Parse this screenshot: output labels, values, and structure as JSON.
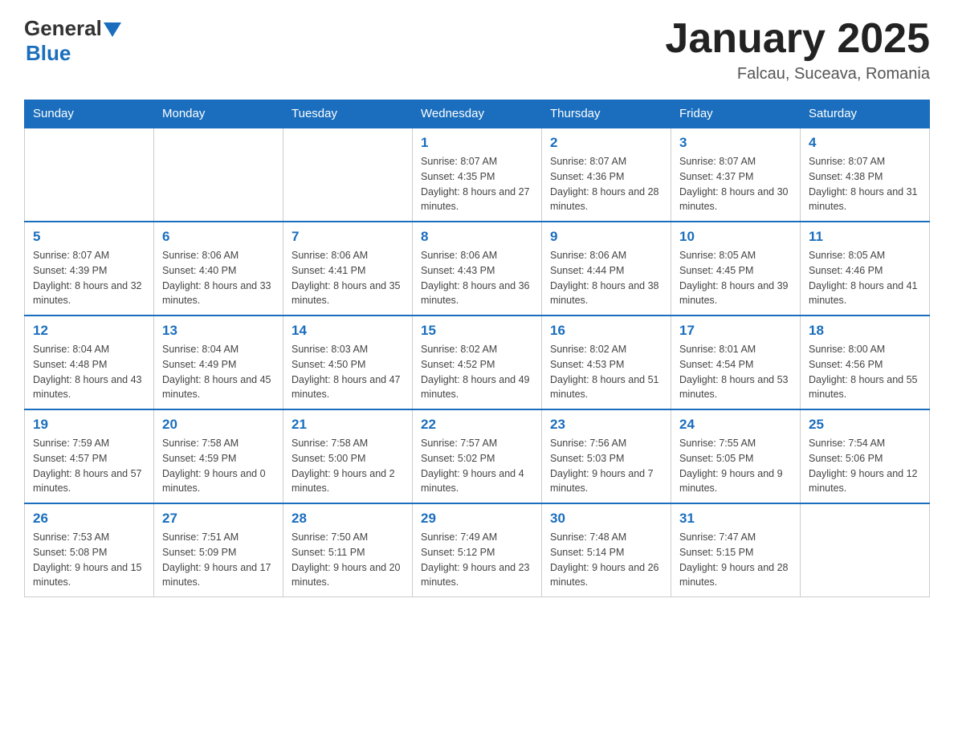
{
  "header": {
    "title": "January 2025",
    "location": "Falcau, Suceava, Romania",
    "logo_general": "General",
    "logo_blue": "Blue"
  },
  "days_of_week": [
    "Sunday",
    "Monday",
    "Tuesday",
    "Wednesday",
    "Thursday",
    "Friday",
    "Saturday"
  ],
  "weeks": [
    [
      {
        "day": "",
        "info": ""
      },
      {
        "day": "",
        "info": ""
      },
      {
        "day": "",
        "info": ""
      },
      {
        "day": "1",
        "info": "Sunrise: 8:07 AM\nSunset: 4:35 PM\nDaylight: 8 hours\nand 27 minutes."
      },
      {
        "day": "2",
        "info": "Sunrise: 8:07 AM\nSunset: 4:36 PM\nDaylight: 8 hours\nand 28 minutes."
      },
      {
        "day": "3",
        "info": "Sunrise: 8:07 AM\nSunset: 4:37 PM\nDaylight: 8 hours\nand 30 minutes."
      },
      {
        "day": "4",
        "info": "Sunrise: 8:07 AM\nSunset: 4:38 PM\nDaylight: 8 hours\nand 31 minutes."
      }
    ],
    [
      {
        "day": "5",
        "info": "Sunrise: 8:07 AM\nSunset: 4:39 PM\nDaylight: 8 hours\nand 32 minutes."
      },
      {
        "day": "6",
        "info": "Sunrise: 8:06 AM\nSunset: 4:40 PM\nDaylight: 8 hours\nand 33 minutes."
      },
      {
        "day": "7",
        "info": "Sunrise: 8:06 AM\nSunset: 4:41 PM\nDaylight: 8 hours\nand 35 minutes."
      },
      {
        "day": "8",
        "info": "Sunrise: 8:06 AM\nSunset: 4:43 PM\nDaylight: 8 hours\nand 36 minutes."
      },
      {
        "day": "9",
        "info": "Sunrise: 8:06 AM\nSunset: 4:44 PM\nDaylight: 8 hours\nand 38 minutes."
      },
      {
        "day": "10",
        "info": "Sunrise: 8:05 AM\nSunset: 4:45 PM\nDaylight: 8 hours\nand 39 minutes."
      },
      {
        "day": "11",
        "info": "Sunrise: 8:05 AM\nSunset: 4:46 PM\nDaylight: 8 hours\nand 41 minutes."
      }
    ],
    [
      {
        "day": "12",
        "info": "Sunrise: 8:04 AM\nSunset: 4:48 PM\nDaylight: 8 hours\nand 43 minutes."
      },
      {
        "day": "13",
        "info": "Sunrise: 8:04 AM\nSunset: 4:49 PM\nDaylight: 8 hours\nand 45 minutes."
      },
      {
        "day": "14",
        "info": "Sunrise: 8:03 AM\nSunset: 4:50 PM\nDaylight: 8 hours\nand 47 minutes."
      },
      {
        "day": "15",
        "info": "Sunrise: 8:02 AM\nSunset: 4:52 PM\nDaylight: 8 hours\nand 49 minutes."
      },
      {
        "day": "16",
        "info": "Sunrise: 8:02 AM\nSunset: 4:53 PM\nDaylight: 8 hours\nand 51 minutes."
      },
      {
        "day": "17",
        "info": "Sunrise: 8:01 AM\nSunset: 4:54 PM\nDaylight: 8 hours\nand 53 minutes."
      },
      {
        "day": "18",
        "info": "Sunrise: 8:00 AM\nSunset: 4:56 PM\nDaylight: 8 hours\nand 55 minutes."
      }
    ],
    [
      {
        "day": "19",
        "info": "Sunrise: 7:59 AM\nSunset: 4:57 PM\nDaylight: 8 hours\nand 57 minutes."
      },
      {
        "day": "20",
        "info": "Sunrise: 7:58 AM\nSunset: 4:59 PM\nDaylight: 9 hours\nand 0 minutes."
      },
      {
        "day": "21",
        "info": "Sunrise: 7:58 AM\nSunset: 5:00 PM\nDaylight: 9 hours\nand 2 minutes."
      },
      {
        "day": "22",
        "info": "Sunrise: 7:57 AM\nSunset: 5:02 PM\nDaylight: 9 hours\nand 4 minutes."
      },
      {
        "day": "23",
        "info": "Sunrise: 7:56 AM\nSunset: 5:03 PM\nDaylight: 9 hours\nand 7 minutes."
      },
      {
        "day": "24",
        "info": "Sunrise: 7:55 AM\nSunset: 5:05 PM\nDaylight: 9 hours\nand 9 minutes."
      },
      {
        "day": "25",
        "info": "Sunrise: 7:54 AM\nSunset: 5:06 PM\nDaylight: 9 hours\nand 12 minutes."
      }
    ],
    [
      {
        "day": "26",
        "info": "Sunrise: 7:53 AM\nSunset: 5:08 PM\nDaylight: 9 hours\nand 15 minutes."
      },
      {
        "day": "27",
        "info": "Sunrise: 7:51 AM\nSunset: 5:09 PM\nDaylight: 9 hours\nand 17 minutes."
      },
      {
        "day": "28",
        "info": "Sunrise: 7:50 AM\nSunset: 5:11 PM\nDaylight: 9 hours\nand 20 minutes."
      },
      {
        "day": "29",
        "info": "Sunrise: 7:49 AM\nSunset: 5:12 PM\nDaylight: 9 hours\nand 23 minutes."
      },
      {
        "day": "30",
        "info": "Sunrise: 7:48 AM\nSunset: 5:14 PM\nDaylight: 9 hours\nand 26 minutes."
      },
      {
        "day": "31",
        "info": "Sunrise: 7:47 AM\nSunset: 5:15 PM\nDaylight: 9 hours\nand 28 minutes."
      },
      {
        "day": "",
        "info": ""
      }
    ]
  ]
}
